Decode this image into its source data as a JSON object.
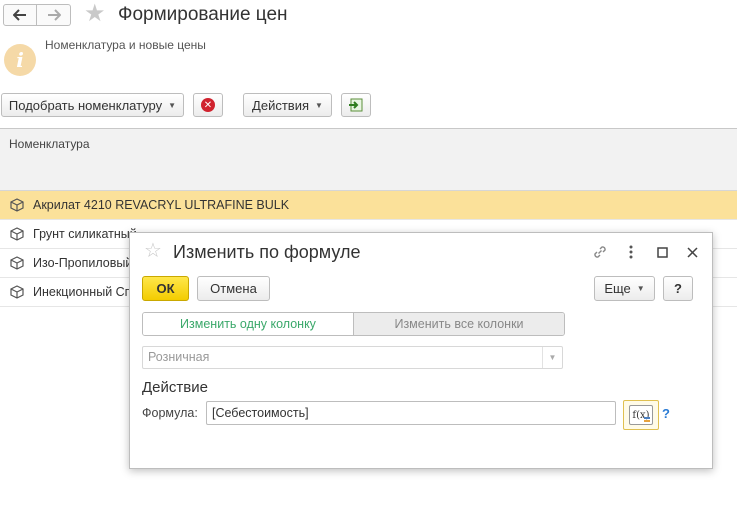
{
  "window": {
    "title": "Формирование цен",
    "info_text": "Номенклатура и новые цены"
  },
  "toolbar": {
    "pick_label": "Подобрать номенклатуру",
    "actions_label": "Действия"
  },
  "grid": {
    "column_header": "Номенклатура",
    "rows": [
      {
        "name": "Акрилат 4210 REVACRYL ULTRAFINE BULK",
        "selected": true
      },
      {
        "name": "Грунт силикатный"
      },
      {
        "name": "Изо-Пропиловый"
      },
      {
        "name": "Инекционный Сп"
      }
    ]
  },
  "modal": {
    "title": "Изменить по формуле",
    "ok_label": "ОК",
    "cancel_label": "Отмена",
    "more_label": "Еще",
    "help_label": "?",
    "tab_one_column": "Изменить одну колонку",
    "tab_all_columns": "Изменить все колонки",
    "price_type": "Розничная",
    "section_title": "Действие",
    "formula_label": "Формула:",
    "formula_value": "[Себестоимость]",
    "fx_label": "f(x)",
    "help_link": "?"
  },
  "colors": {
    "selected_row": "#fbe19a",
    "ok_button": "#f3cc00",
    "active_tab_text": "#3aa86a",
    "link": "#2a7bd5"
  }
}
